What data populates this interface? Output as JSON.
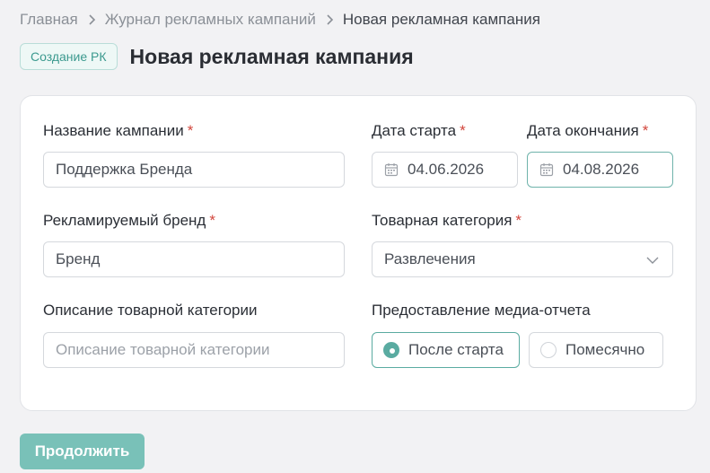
{
  "breadcrumb": {
    "items": [
      "Главная",
      "Журнал рекламных кампаний",
      "Новая рекламная кампания"
    ]
  },
  "header": {
    "badge": "Создание РК",
    "title": "Новая рекламная кампания"
  },
  "form": {
    "campaign_name": {
      "label": "Название кампании",
      "required": "*",
      "value": "Поддержка Бренда"
    },
    "start_date": {
      "label": "Дата старта",
      "required": "*",
      "value": "04.06.2026",
      "icon": "calendar-icon"
    },
    "end_date": {
      "label": "Дата окончания",
      "required": "*",
      "value": "04.08.2026",
      "icon": "calendar-icon"
    },
    "brand": {
      "label": "Рекламируемый бренд",
      "required": "*",
      "value": "Бренд"
    },
    "category": {
      "label": "Товарная категория",
      "required": "*",
      "value": "Развлечения",
      "icon": "chevron-down-icon"
    },
    "category_description": {
      "label": "Описание товарной категории",
      "placeholder": "Описание товарной категории"
    },
    "media_report": {
      "label": "Предоставление медиа-отчета",
      "options": [
        "После старта",
        "Помесячно"
      ],
      "selected": "После старта"
    }
  },
  "actions": {
    "continue_label": "Продолжить"
  },
  "colors": {
    "accent": "#5aaba1",
    "button": "#79c1b8",
    "required": "#d2463c",
    "badge_text": "#3c9a8f"
  }
}
